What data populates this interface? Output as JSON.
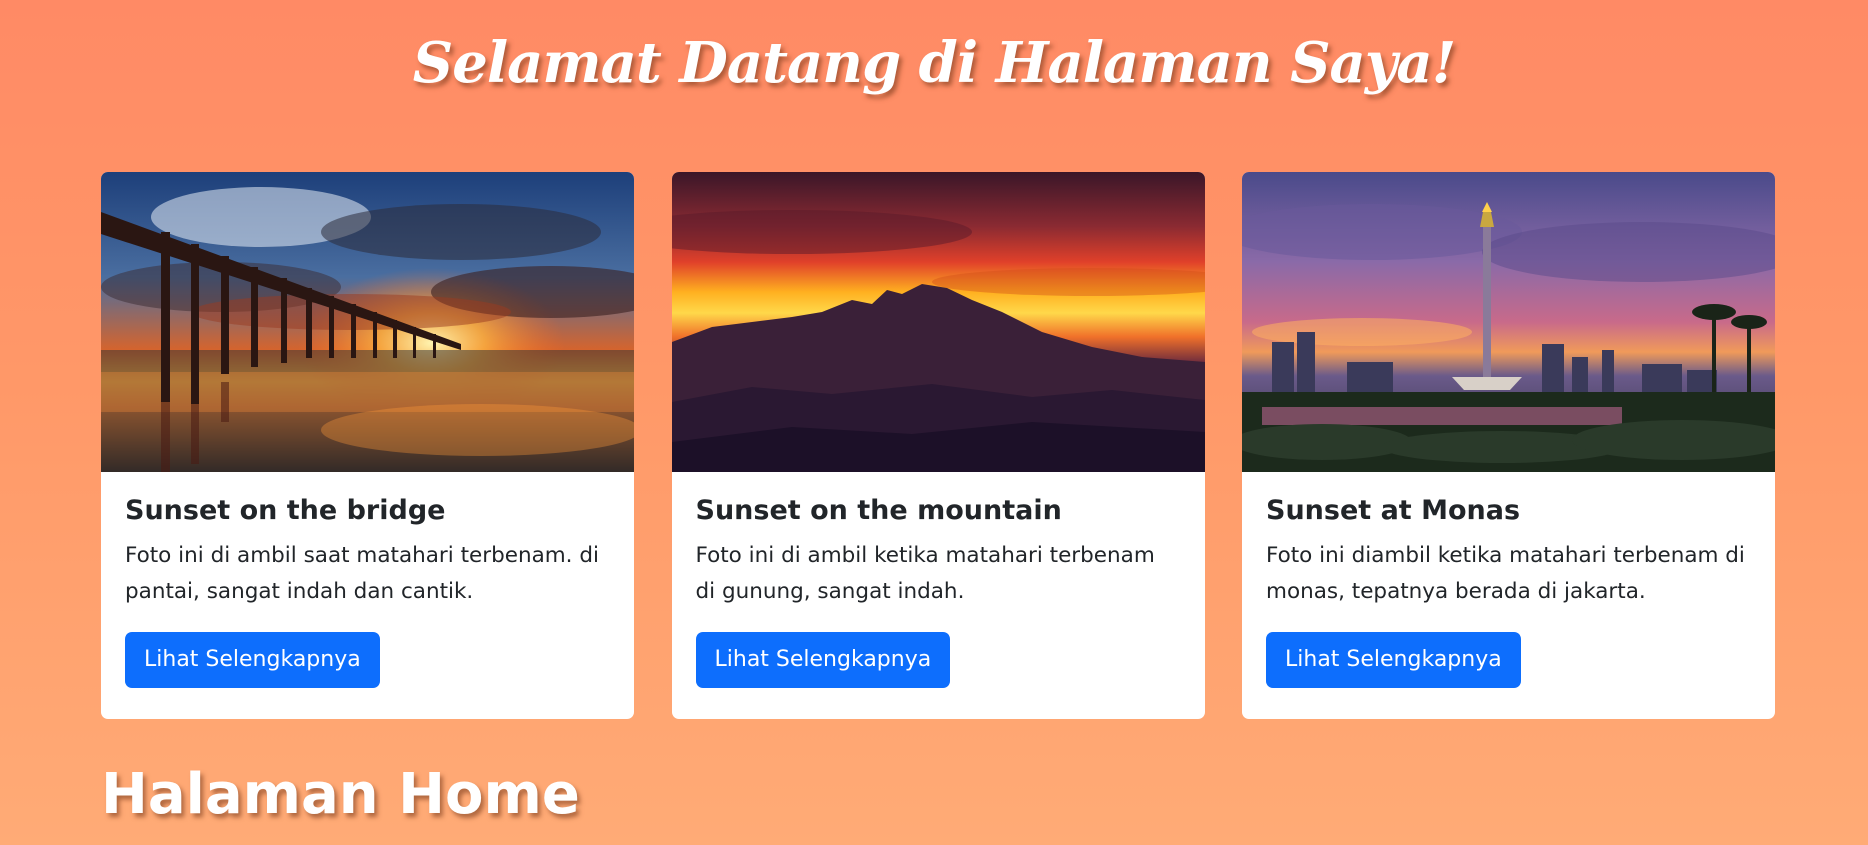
{
  "header": {
    "title": "Selamat Datang di Halaman Saya!"
  },
  "cards": [
    {
      "image": "sunset-bridge-photo",
      "title": "Sunset on the bridge",
      "text": "Foto ini di ambil saat matahari terbenam. di pantai, sangat indah dan cantik.",
      "button_label": "Lihat Selengkapnya"
    },
    {
      "image": "sunset-mountain-photo",
      "title": "Sunset on the mountain",
      "text": "Foto ini di ambil ketika matahari terbenam di gunung, sangat indah.",
      "button_label": "Lihat Selengkapnya"
    },
    {
      "image": "sunset-monas-photo",
      "title": "Sunset at Monas",
      "text": "Foto ini diambil ketika matahari terbenam di monas, tepatnya berada di jakarta.",
      "button_label": "Lihat Selengkapnya"
    }
  ],
  "section": {
    "heading": "Halaman Home"
  },
  "colors": {
    "background_top": "#ff8a65",
    "background_bottom": "#ffab76",
    "button": "#0d6efd",
    "card_background": "#ffffff",
    "text": "#212529"
  }
}
